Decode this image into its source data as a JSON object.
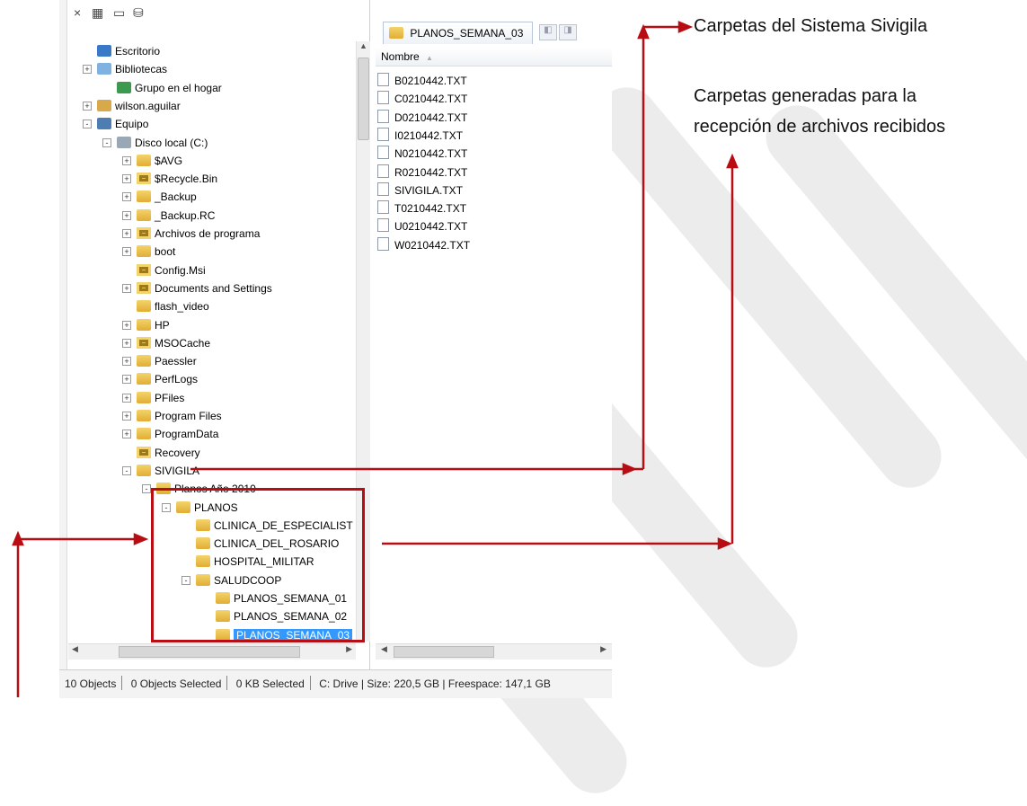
{
  "tree": {
    "items": [
      {
        "label": "Escritorio",
        "icon": "desktop-icon"
      },
      {
        "label": "Bibliotecas",
        "icon": "library-icon",
        "expander": "+"
      },
      {
        "label": "Grupo en el hogar",
        "icon": "homegroup-icon"
      },
      {
        "label": "wilson.aguilar",
        "icon": "user-folder-icon",
        "expander": "+"
      },
      {
        "label": "Equipo",
        "icon": "computer-icon",
        "expander": "-"
      },
      {
        "label": "Disco local (C:)",
        "icon": "drive-icon",
        "expander": "-"
      },
      {
        "label": "$AVG",
        "icon": "folder-icon",
        "expander": "+"
      },
      {
        "label": "$Recycle.Bin",
        "icon": "lock-folder-icon",
        "expander": "+"
      },
      {
        "label": "_Backup",
        "icon": "folder-icon",
        "expander": "+"
      },
      {
        "label": "_Backup.RC",
        "icon": "folder-icon",
        "expander": "+"
      },
      {
        "label": "Archivos de programa",
        "icon": "lock-folder-icon",
        "expander": "+"
      },
      {
        "label": "boot",
        "icon": "folder-icon",
        "expander": "+"
      },
      {
        "label": "Config.Msi",
        "icon": "lock-folder-icon"
      },
      {
        "label": "Documents and Settings",
        "icon": "lock-folder-icon",
        "expander": "+"
      },
      {
        "label": "flash_video",
        "icon": "folder-icon"
      },
      {
        "label": "HP",
        "icon": "folder-icon",
        "expander": "+"
      },
      {
        "label": "MSOCache",
        "icon": "lock-folder-icon",
        "expander": "+"
      },
      {
        "label": "Paessler",
        "icon": "folder-icon",
        "expander": "+"
      },
      {
        "label": "PerfLogs",
        "icon": "folder-icon",
        "expander": "+"
      },
      {
        "label": "PFiles",
        "icon": "folder-icon",
        "expander": "+"
      },
      {
        "label": "Program Files",
        "icon": "folder-icon",
        "expander": "+"
      },
      {
        "label": "ProgramData",
        "icon": "folder-icon",
        "expander": "+"
      },
      {
        "label": "Recovery",
        "icon": "lock-folder-icon"
      },
      {
        "label": "SIVIGILA",
        "icon": "folder-icon",
        "expander": "-"
      },
      {
        "label": "Planos Año 2010",
        "icon": "folder-icon",
        "expander": "-"
      },
      {
        "label": "PLANOS",
        "icon": "folder-icon",
        "expander": "-"
      },
      {
        "label": "CLINICA_DE_ESPECIALIST",
        "icon": "folder-icon"
      },
      {
        "label": "CLINICA_DEL_ROSARIO",
        "icon": "folder-icon"
      },
      {
        "label": "HOSPITAL_MILITAR",
        "icon": "folder-icon"
      },
      {
        "label": "SALUDCOOP",
        "icon": "folder-icon",
        "expander": "-"
      },
      {
        "label": "PLANOS_SEMANA_01",
        "icon": "folder-icon"
      },
      {
        "label": "PLANOS_SEMANA_02",
        "icon": "folder-icon"
      },
      {
        "label": "PLANOS_SEMANA_03",
        "icon": "folder-icon",
        "selected": true
      }
    ]
  },
  "right": {
    "tab_label": "PLANOS_SEMANA_03",
    "column_header": "Nombre",
    "files": [
      "B0210442.TXT",
      "C0210442.TXT",
      "D0210442.TXT",
      "I0210442.TXT",
      "N0210442.TXT",
      "R0210442.TXT",
      "SIVIGILA.TXT",
      "T0210442.TXT",
      "U0210442.TXT",
      "W0210442.TXT"
    ]
  },
  "status": {
    "objects": "10 Objects",
    "selected": "0 Objects Selected",
    "size_selected": "0 KB Selected",
    "drive": "C: Drive | Size: 220,5 GB | Freespace: 147,1 GB"
  },
  "annotations": {
    "sistema": "Carpetas del Sistema Sivigila",
    "generadas_1": "Carpetas generadas para la",
    "generadas_2": "recepción de archivos recibidos"
  },
  "colors": {
    "selection": "#3399ff",
    "annotation_red": "#b80d12"
  }
}
